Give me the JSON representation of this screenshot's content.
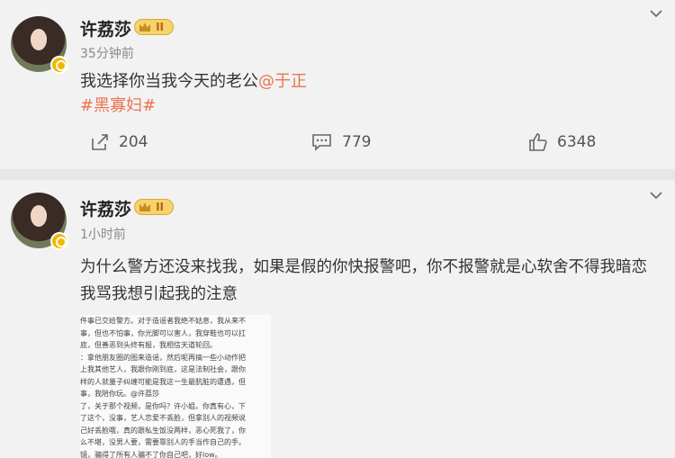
{
  "posts": [
    {
      "username": "许荔莎",
      "vip_level": "II",
      "time": "35分钟前",
      "text": "我选择你当我今天的老公",
      "mention": "@于正",
      "topic": "#黑寡妇#",
      "repost_count": "204",
      "comment_count": "779",
      "like_count": "6348"
    },
    {
      "username": "许荔莎",
      "vip_level": "II",
      "time": "1小时前",
      "text_line1": "为什么警方还没来找我，如果是假的你快报警吧，你不报警就是心软舍不得我暗恋",
      "text_line2": "我骂我想引起我的注意",
      "image_lines": [
        "件事已交给警方。对于造谣者我绝不姑息，我从来不",
        "事，但也不怕事，你光脚可以害人，我穿鞋也可以扛",
        "底，但善恶到头终有报，我相信天道轮回。",
        "：拿他朋友圈的图来造谣，然后呢再搞一些小动作把",
        "上我其他艺人，我跟你刚到底，这是法制社会，跟你",
        "样的人就量子纠缠可能是我这一生最肮脏的遭遇，但",
        "事，我陪你玩。@许荔莎",
        "了，关于那个视频，是你吗？许小姐。你真有心，下",
        "了这个，没事，艺人恋爱不丢脸，但拿别人的视频说",
        "己好丢脸哦，真的跟私生饭没两样，恶心死我了，你",
        "么不堪，没男人要，需要靠别人的手当作自己的手。",
        "镜，骗得了所有人骗不了你自己吧，好low。"
      ]
    }
  ],
  "colors": {
    "link": "#eb7350",
    "background": "#f2f2f2"
  }
}
